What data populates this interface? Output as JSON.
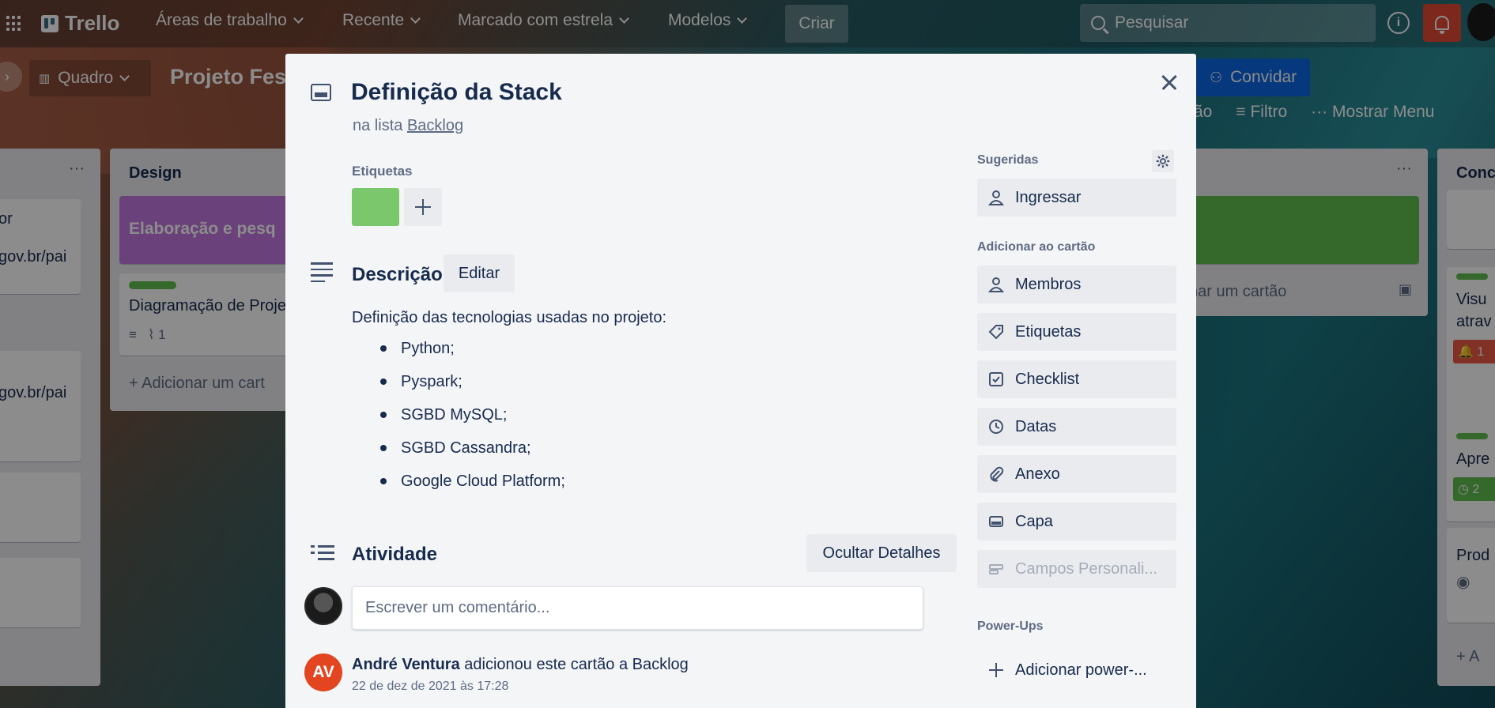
{
  "topbar": {
    "app_name": "Trello",
    "nav": [
      {
        "label": "Áreas de trabalho"
      },
      {
        "label": "Recente"
      },
      {
        "label": "Marcado com estrela"
      },
      {
        "label": "Modelos"
      }
    ],
    "create_label": "Criar",
    "search_placeholder": "Pesquisar",
    "info_glyph": "i"
  },
  "board": {
    "view_label": "Quadro",
    "title": "Projeto Fest",
    "invite_label": "Convidar",
    "filter_label": "Filtro",
    "menu_label": "Mostrar Menu",
    "filter_prefix": "ão",
    "lists": [
      {
        "name": "",
        "cards": [
          {
            "text": "or"
          },
          {
            "text": "gov.br/pai"
          },
          {
            "text": "gov.br/pai"
          }
        ]
      },
      {
        "name": "Design",
        "cards": [
          {
            "text": "Elaboração e pesq"
          },
          {
            "text": "Diagramação de Proje",
            "attachments": "1"
          }
        ],
        "add_card": "Adicionar um cart"
      },
      {
        "name": "",
        "add_card": "nar um cartão"
      },
      {
        "name": "Conc",
        "cards": [
          {
            "text": "Visu"
          },
          {
            "text": "atrav"
          },
          {
            "text": "Apre"
          },
          {
            "text": "Prod"
          }
        ],
        "badge_count": "1",
        "badge_count_2": "2",
        "add_card": "A"
      }
    ]
  },
  "card_modal": {
    "title": "Definição da Stack",
    "list_prefix": "na lista",
    "list_name": "Backlog",
    "labels_heading": "Etiquetas",
    "label_color": "#7bc86c",
    "description_heading": "Descrição",
    "edit_label": "Editar",
    "description_intro": "Definição das tecnologias usadas no projeto:",
    "description_items": [
      "Python;",
      "Pyspark;",
      "SGBD MySQL;",
      "SGBD Cassandra;",
      "Google Cloud Platform;"
    ],
    "activity_heading": "Atividade",
    "hide_details_label": "Ocultar Detalhes",
    "comment_placeholder": "Escrever um comentário...",
    "activity": {
      "initials": "AV",
      "user": "André Ventura",
      "action": "adicionou este cartão a Backlog",
      "time": "22 de dez de 2021 às 17:28"
    },
    "sidebar": {
      "suggested_heading": "Sugeridas",
      "join_label": "Ingressar",
      "add_heading": "Adicionar ao cartão",
      "buttons": [
        {
          "label": "Membros",
          "icon": "person-icon"
        },
        {
          "label": "Etiquetas",
          "icon": "tag-icon"
        },
        {
          "label": "Checklist",
          "icon": "checklist-icon"
        },
        {
          "label": "Datas",
          "icon": "clock-icon"
        },
        {
          "label": "Anexo",
          "icon": "paperclip-icon"
        },
        {
          "label": "Capa",
          "icon": "cover-icon"
        },
        {
          "label": "Campos Personali...",
          "icon": "custom-fields-icon"
        }
      ],
      "powerups_heading": "Power-Ups",
      "add_powerup_label": "Adicionar power-..."
    }
  },
  "colors": {
    "accent": "#0c66e4",
    "notification": "#e34935",
    "avatar_bg": "#e2451f"
  }
}
